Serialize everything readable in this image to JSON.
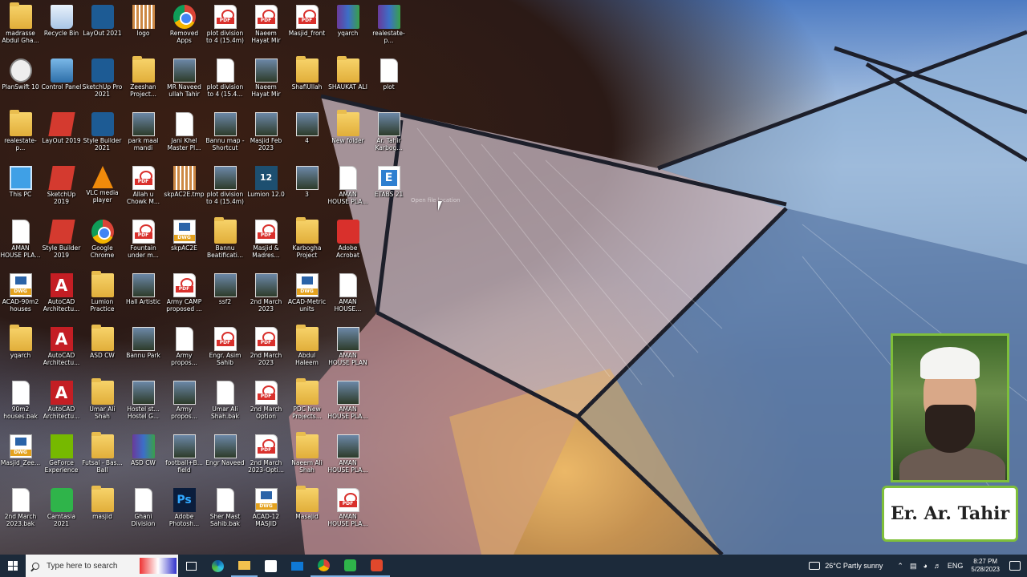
{
  "desktop": {
    "icons": [
      {
        "label": "madrasse Abdul Gha...",
        "type": "folder",
        "col": 0,
        "row": 0
      },
      {
        "label": "Recycle Bin",
        "type": "recycle",
        "col": 1,
        "row": 0
      },
      {
        "label": "LayOut 2021",
        "type": "style",
        "col": 2,
        "row": 0
      },
      {
        "label": "logo",
        "type": "logo",
        "col": 3,
        "row": 0
      },
      {
        "label": "Removed Apps",
        "type": "chrome",
        "col": 4,
        "row": 0
      },
      {
        "label": "plot division to 4 (15.4m)",
        "type": "pdf",
        "col": 5,
        "row": 0
      },
      {
        "label": "Naeem Hayat Mir",
        "type": "pdf",
        "col": 6,
        "row": 0
      },
      {
        "label": "Masjid_front",
        "type": "pdf",
        "col": 7,
        "row": 0
      },
      {
        "label": "yqarch",
        "type": "winrar",
        "col": 8,
        "row": 0
      },
      {
        "label": "realestate-p...",
        "type": "winrar",
        "col": 9,
        "row": 0
      },
      {
        "label": "PlanSwift 10",
        "type": "plan",
        "col": 0,
        "row": 1
      },
      {
        "label": "Control Panel",
        "type": "cp",
        "col": 1,
        "row": 1
      },
      {
        "label": "SketchUp Pro 2021",
        "type": "style",
        "col": 2,
        "row": 1
      },
      {
        "label": "Zeeshan Project...",
        "type": "folder",
        "col": 3,
        "row": 1
      },
      {
        "label": "MR Naveed ullah Tahir",
        "type": "img",
        "col": 4,
        "row": 1
      },
      {
        "label": "plot division to 4 (15.4...",
        "type": "file",
        "col": 5,
        "row": 1
      },
      {
        "label": "Naeem Hayat Mir",
        "type": "img",
        "col": 6,
        "row": 1
      },
      {
        "label": "ShafiUllah",
        "type": "folder",
        "col": 7,
        "row": 1
      },
      {
        "label": "SHAUKAT ALI",
        "type": "folder",
        "col": 8,
        "row": 1
      },
      {
        "label": "plot",
        "type": "file",
        "col": 9,
        "row": 1
      },
      {
        "label": "realestate-p...",
        "type": "folder",
        "col": 0,
        "row": 2
      },
      {
        "label": "LayOut 2019",
        "type": "sketch",
        "col": 1,
        "row": 2
      },
      {
        "label": "Style Builder 2021",
        "type": "style",
        "col": 2,
        "row": 2
      },
      {
        "label": "park maal mandi",
        "type": "img",
        "col": 3,
        "row": 2
      },
      {
        "label": "Jani Khel Master Pl...",
        "type": "file",
        "col": 4,
        "row": 2
      },
      {
        "label": "Bannu map - Shortcut",
        "type": "img",
        "col": 5,
        "row": 2
      },
      {
        "label": "Masjid Feb 2023",
        "type": "img",
        "col": 6,
        "row": 2
      },
      {
        "label": "4",
        "type": "img",
        "col": 7,
        "row": 2
      },
      {
        "label": "New folder",
        "type": "folder",
        "col": 8,
        "row": 2
      },
      {
        "label": "Ar. Tahir Karbog...",
        "type": "img",
        "col": 9,
        "row": 2
      },
      {
        "label": "This PC",
        "type": "pc",
        "col": 0,
        "row": 3
      },
      {
        "label": "SketchUp 2019",
        "type": "sketch",
        "col": 1,
        "row": 3
      },
      {
        "label": "VLC media player",
        "type": "vlc",
        "col": 2,
        "row": 3
      },
      {
        "label": "Allah u Chowk M...",
        "type": "pdf",
        "col": 3,
        "row": 3
      },
      {
        "label": "skpAC2E.tmp",
        "type": "logo",
        "col": 4,
        "row": 3
      },
      {
        "label": "plot division to 4 (15.4m)",
        "type": "img",
        "col": 5,
        "row": 3
      },
      {
        "label": "Lumion 12.0",
        "type": "lumion",
        "col": 6,
        "row": 3
      },
      {
        "label": "3",
        "type": "img",
        "col": 7,
        "row": 3
      },
      {
        "label": "AMAN HOUSE PLA...",
        "type": "file",
        "col": 8,
        "row": 3
      },
      {
        "label": "ETABS 21",
        "type": "etabs",
        "col": 9,
        "row": 3
      },
      {
        "label": "AMAN HOUSE PLA...",
        "type": "file",
        "col": 0,
        "row": 4
      },
      {
        "label": "Style Builder 2019",
        "type": "sketch",
        "col": 1,
        "row": 4
      },
      {
        "label": "Google Chrome",
        "type": "chrome",
        "col": 2,
        "row": 4
      },
      {
        "label": "Fountain under m...",
        "type": "pdf",
        "col": 3,
        "row": 4
      },
      {
        "label": "skpAC2E",
        "type": "dwg",
        "col": 4,
        "row": 4
      },
      {
        "label": "Bannu Beatificati...",
        "type": "folder",
        "col": 5,
        "row": 4
      },
      {
        "label": "Masjid & Madres...",
        "type": "pdf",
        "col": 6,
        "row": 4
      },
      {
        "label": "Karbogha Project",
        "type": "folder",
        "col": 7,
        "row": 4
      },
      {
        "label": "Adobe Acrobat",
        "type": "acrobat",
        "col": 8,
        "row": 4
      },
      {
        "label": "ACAD-90m2 houses",
        "type": "dwg",
        "col": 0,
        "row": 5
      },
      {
        "label": "AutoCAD Architectu...",
        "type": "acad",
        "col": 1,
        "row": 5
      },
      {
        "label": "Lumion Practice",
        "type": "folder",
        "col": 2,
        "row": 5
      },
      {
        "label": "Hall Artistic",
        "type": "img",
        "col": 3,
        "row": 5
      },
      {
        "label": "Army CAMP proposed ...",
        "type": "pdf",
        "col": 4,
        "row": 5
      },
      {
        "label": "ssf2",
        "type": "img",
        "col": 5,
        "row": 5
      },
      {
        "label": "2nd March 2023",
        "type": "img",
        "col": 6,
        "row": 5
      },
      {
        "label": "ACAD-Metric units",
        "type": "dwg",
        "col": 7,
        "row": 5
      },
      {
        "label": "AMAN HOUSE...",
        "type": "file",
        "col": 8,
        "row": 5
      },
      {
        "label": "yqarch",
        "type": "folder",
        "col": 0,
        "row": 6
      },
      {
        "label": "AutoCAD Architectu...",
        "type": "acad",
        "col": 1,
        "row": 6
      },
      {
        "label": "ASD CW",
        "type": "folder",
        "col": 2,
        "row": 6
      },
      {
        "label": "Bannu Park",
        "type": "img",
        "col": 3,
        "row": 6
      },
      {
        "label": "Army propos...",
        "type": "file",
        "col": 4,
        "row": 6
      },
      {
        "label": "Engr. Asim Sahib",
        "type": "pdf",
        "col": 5,
        "row": 6
      },
      {
        "label": "2nd March 2023",
        "type": "pdf",
        "col": 6,
        "row": 6
      },
      {
        "label": "Abdul Haleem",
        "type": "folder",
        "col": 7,
        "row": 6
      },
      {
        "label": "AMAN HOUSE PLAN",
        "type": "img",
        "col": 8,
        "row": 6
      },
      {
        "label": "90m2 houses.bak",
        "type": "file",
        "col": 0,
        "row": 7
      },
      {
        "label": "AutoCAD Architectu...",
        "type": "acad",
        "col": 1,
        "row": 7
      },
      {
        "label": "Umar Ali Shah",
        "type": "folder",
        "col": 2,
        "row": 7
      },
      {
        "label": "Hostel st... Hostel G...",
        "type": "img",
        "col": 3,
        "row": 7
      },
      {
        "label": "Army propos...",
        "type": "img",
        "col": 4,
        "row": 7
      },
      {
        "label": "Umar Ali Shah.bak",
        "type": "file",
        "col": 5,
        "row": 7
      },
      {
        "label": "2nd March Option",
        "type": "pdf",
        "col": 6,
        "row": 7
      },
      {
        "label": "PDC New Projects...",
        "type": "folder",
        "col": 7,
        "row": 7
      },
      {
        "label": "AMAN HOUSE PLA...",
        "type": "img",
        "col": 8,
        "row": 7
      },
      {
        "label": "Masjid_Zee...",
        "type": "dwg",
        "col": 0,
        "row": 8
      },
      {
        "label": "GeForce Experience",
        "type": "nvidia",
        "col": 1,
        "row": 8
      },
      {
        "label": "Futsal - Bas... Ball",
        "type": "folder",
        "col": 2,
        "row": 8
      },
      {
        "label": "ASD CW",
        "type": "winrar",
        "col": 3,
        "row": 8
      },
      {
        "label": "football+B... field",
        "type": "img",
        "col": 4,
        "row": 8
      },
      {
        "label": "Engr Naveed",
        "type": "img",
        "col": 5,
        "row": 8
      },
      {
        "label": "2nd March 2023-Opti...",
        "type": "pdf",
        "col": 6,
        "row": 8
      },
      {
        "label": "Naeem Ali Shah",
        "type": "folder",
        "col": 7,
        "row": 8
      },
      {
        "label": "AMAN HOUSE PLA...",
        "type": "img",
        "col": 8,
        "row": 8
      },
      {
        "label": "2nd March 2023.bak",
        "type": "file",
        "col": 0,
        "row": 9
      },
      {
        "label": "Camtasia 2021",
        "type": "camtasia",
        "col": 1,
        "row": 9
      },
      {
        "label": "masjid",
        "type": "folder",
        "col": 2,
        "row": 9
      },
      {
        "label": "Ghani Division",
        "type": "file",
        "col": 3,
        "row": 9
      },
      {
        "label": "Adobe Photosh...",
        "type": "ps",
        "col": 4,
        "row": 9
      },
      {
        "label": "Sher Mast Sahib.bak",
        "type": "file",
        "col": 5,
        "row": 9
      },
      {
        "label": "ACAD-12 MASJID",
        "type": "dwg",
        "col": 6,
        "row": 9
      },
      {
        "label": "Masajid",
        "type": "folder",
        "col": 7,
        "row": 9
      },
      {
        "label": "AMAN HOUSE PLA...",
        "type": "pdf",
        "col": 8,
        "row": 9
      }
    ],
    "ghost_text": "Open file location"
  },
  "overlay": {
    "name_card": "Er. Ar. Tahir"
  },
  "taskbar": {
    "search_placeholder": "Type here to search",
    "pinned": [
      "task-view",
      "edge",
      "file-explorer",
      "store",
      "mail",
      "chrome",
      "camtasia",
      "camtasia-recorder"
    ],
    "weather": "26°C  Partly sunny",
    "language": "ENG",
    "time": "8:27 PM",
    "date": "5/28/2023"
  },
  "colors": {
    "taskbar_bg": "#1c2a3a",
    "webcam_border": "#7fbf3a"
  }
}
